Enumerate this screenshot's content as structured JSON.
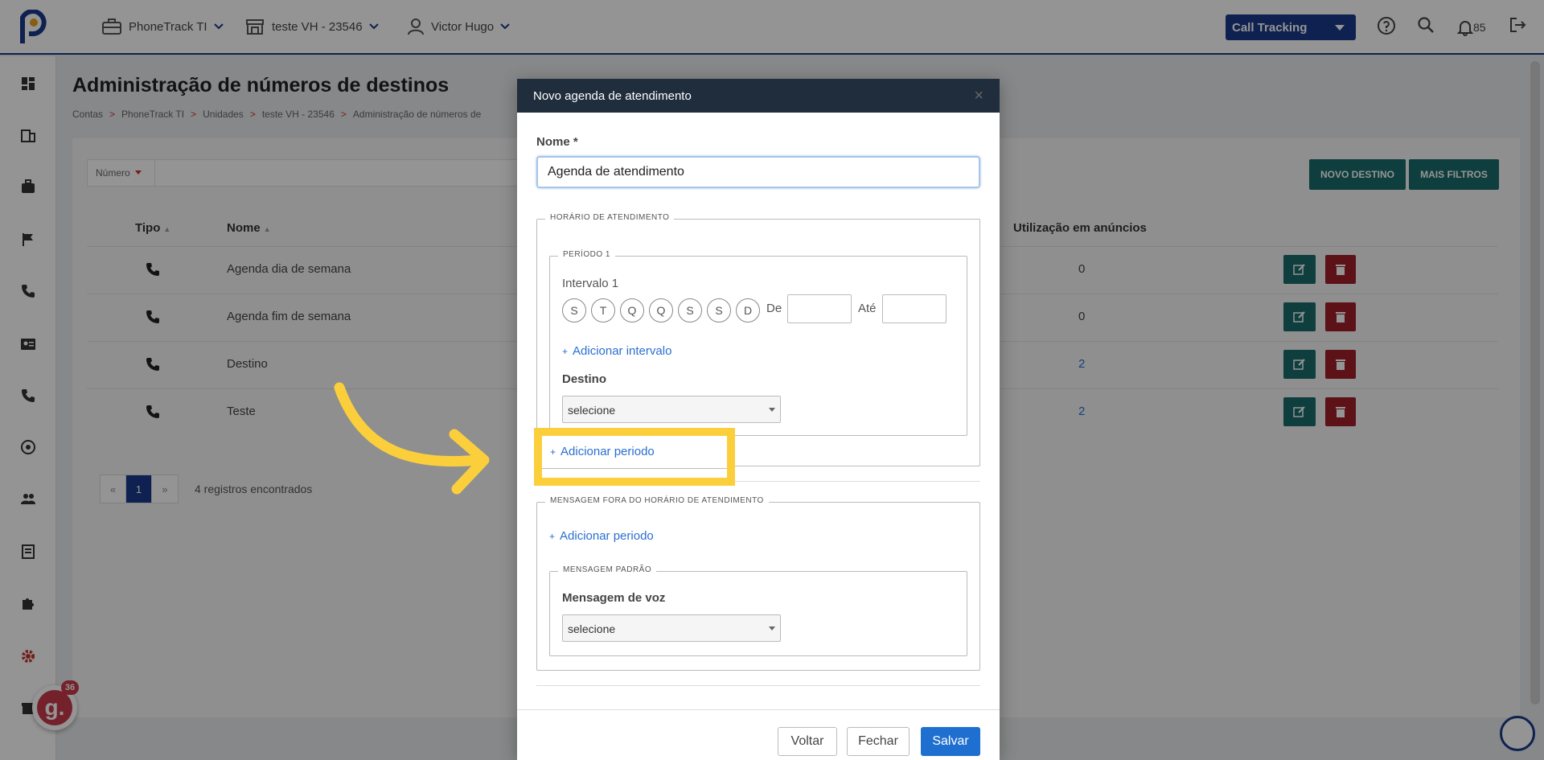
{
  "topbar": {
    "account": "PhoneTrack TI",
    "unit": "teste VH - 23546",
    "user": "Victor Hugo",
    "product_select": "Call Tracking",
    "notifications_count": "85"
  },
  "page": {
    "title": "Administração de números de destinos",
    "breadcrumb": [
      "Contas",
      "PhoneTrack TI",
      "Unidades",
      "teste VH - 23546",
      "Administração de números de"
    ]
  },
  "filter": {
    "field": "Número"
  },
  "buttons": {
    "new_destination": "NOVO DESTINO",
    "more_filters": "MAIS FILTROS"
  },
  "table": {
    "headers": {
      "type": "Tipo",
      "name": "Nome",
      "usage": "Utilização em anúncios"
    },
    "rows": [
      {
        "name": "Agenda dia de semana",
        "usage": "0"
      },
      {
        "name": "Agenda fim de semana",
        "usage": "0"
      },
      {
        "name": "Destino",
        "usage": "2"
      },
      {
        "name": "Teste",
        "usage": "2"
      }
    ]
  },
  "pagination": {
    "prev": "«",
    "current": "1",
    "next": "»",
    "records": "4 registros encontrados"
  },
  "modal": {
    "title": "Novo agenda de atendimento",
    "close": "×",
    "name_label": "Nome *",
    "name_value": "Agenda de atendimento",
    "schedule_legend": "HORÁRIO DE ATENDIMENTO",
    "period_legend": "PERÍODO 1",
    "interval_label": "Intervalo 1",
    "days": [
      "S",
      "T",
      "Q",
      "Q",
      "S",
      "S",
      "D"
    ],
    "from_label": "De",
    "to_label": "Até",
    "add_interval": "Adicionar intervalo",
    "destination_label": "Destino",
    "destination_select": "selecione",
    "add_period": "Adicionar periodo",
    "off_hours_legend": "MENSAGEM FORA DO HORÁRIO DE ATENDIMENTO",
    "add_period_off_hours": "Adicionar periodo",
    "default_message_legend": "MENSAGEM PADRÃO",
    "voice_message_label": "Mensagem de voz",
    "voice_message_select": "selecione",
    "back": "Voltar",
    "close_button": "Fechar",
    "save": "Salvar"
  },
  "guide": {
    "badge_letter": "g.",
    "badge_count": "36"
  },
  "colors": {
    "brand": "#1a3a8a",
    "teal": "#1a6b6b",
    "danger": "#a0202a",
    "highlight": "#fbcf3c",
    "link": "#2a6fd0"
  }
}
